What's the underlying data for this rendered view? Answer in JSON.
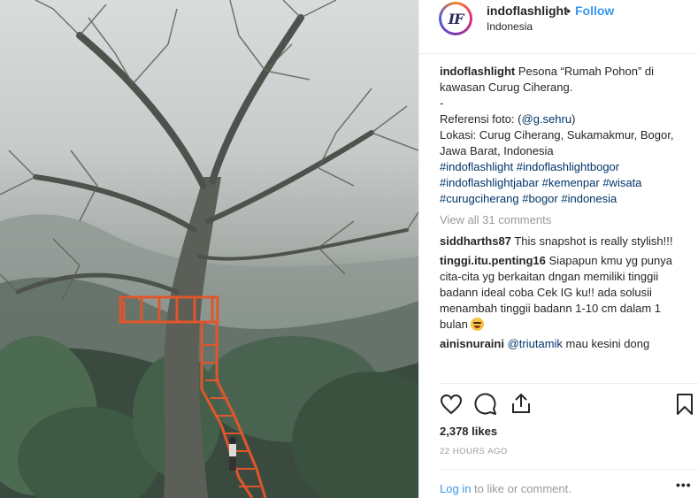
{
  "header": {
    "username": "indoflashlight",
    "separator": "•",
    "follow_label": "Follow",
    "location": "Indonesia",
    "avatar_text": "IF"
  },
  "caption": {
    "username": "indoflashlight",
    "line1": "Pesona “Rumah Pohon” di kawasan Curug Ciherang.",
    "line2": "-",
    "line3_prefix": "Referensi foto: (",
    "line3_mention": "@g.sehru",
    "line3_suffix": ")",
    "line4": "Lokasi: Curug Ciherang, Sukamakmur, Bogor, Jawa Barat, Indonesia",
    "hashtags": [
      "#indoflashlight",
      "#indoflashlightbogor",
      "#indoflashlightjabar",
      "#kemenpar",
      "#wisata",
      "#curugciherang",
      "#bogor",
      "#indonesia"
    ]
  },
  "view_all": "View all 31 comments",
  "comments": [
    {
      "username": "siddharths87",
      "text": "This snapshot is really stylish!!!"
    },
    {
      "username": "tinggi.itu.penting16",
      "text": "Siapapun kmu yg punya cita-cita yg berkaitan dngan memiliki tinggii badann ideal coba Cek IG ku!! ada solusii menambah tinggii badann 1-10 cm dalam 1 bulan"
    },
    {
      "username": "ainisnuraini",
      "mention": "@triutamik",
      "text": "mau kesini dong"
    }
  ],
  "actions": {
    "icons": [
      "heart-icon",
      "comment-icon",
      "share-icon",
      "bookmark-icon"
    ]
  },
  "likes": "2,378 likes",
  "time": "22 HOURS AGO",
  "login": {
    "link": "Log in",
    "text": "to like or comment."
  },
  "more_label": "•••",
  "colors": {
    "link_blue": "#3897f0",
    "hashtag": "#003569",
    "muted": "#999999",
    "stairs": "#e0562a"
  }
}
